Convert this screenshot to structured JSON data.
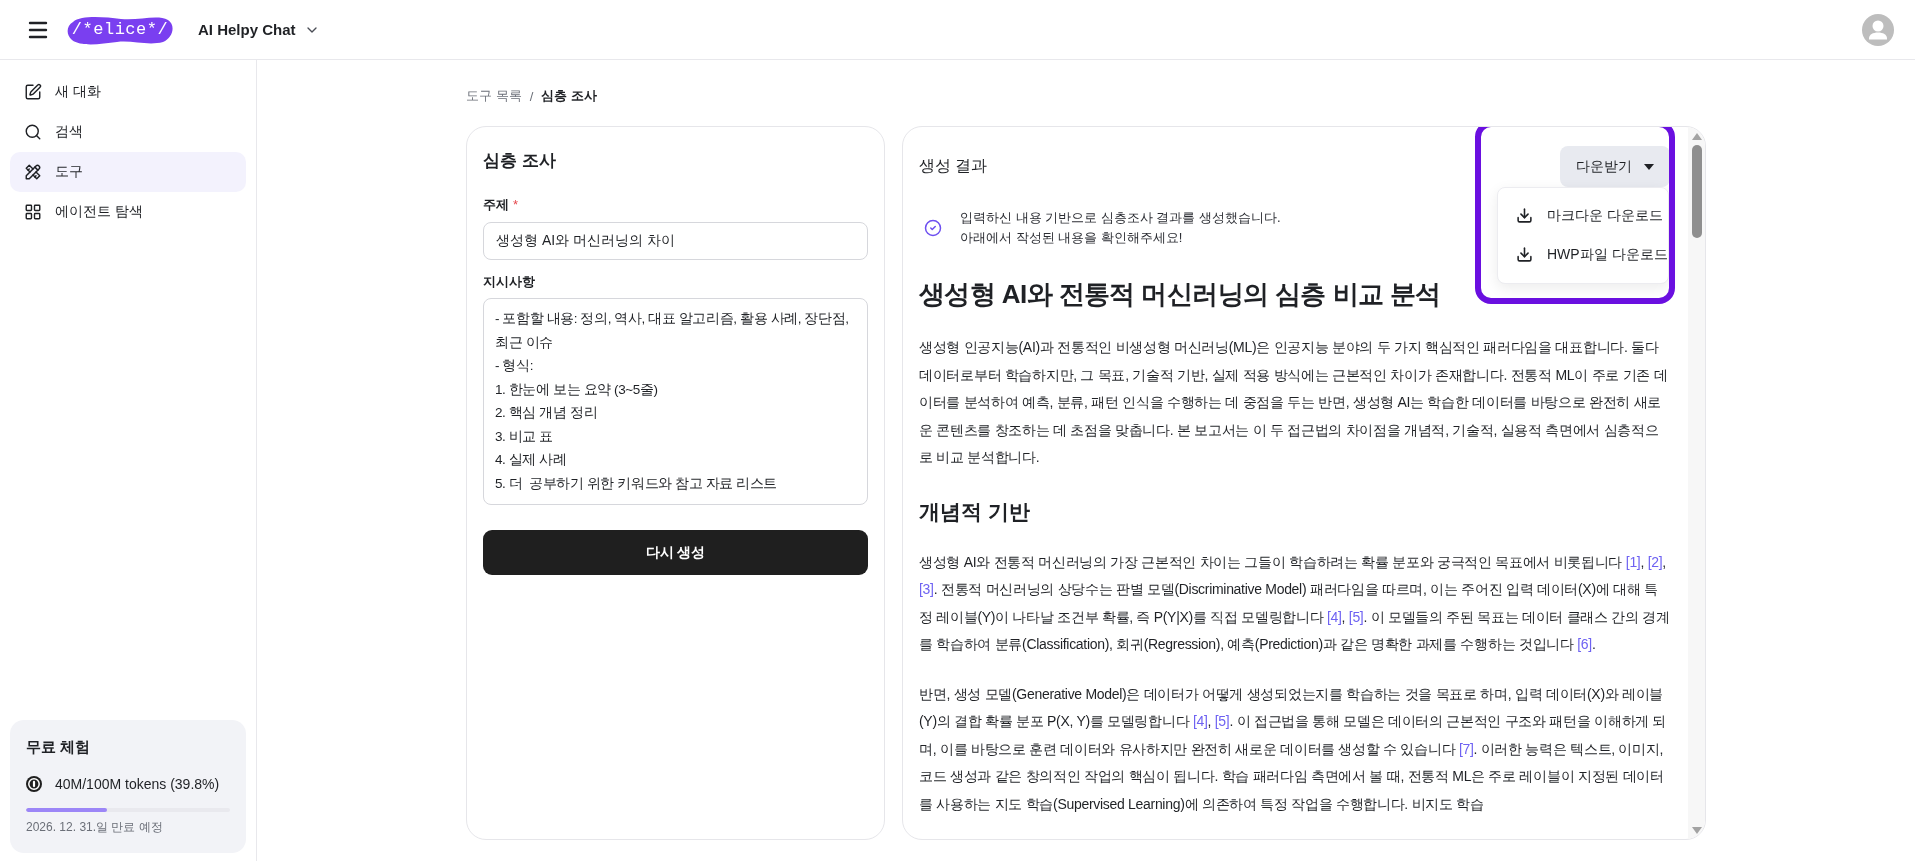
{
  "header": {
    "logo": "/*elice*/",
    "app_selector": "AI Helpy Chat"
  },
  "sidebar": {
    "items": [
      {
        "kind": "new_chat",
        "label": "새 대화",
        "selected": false
      },
      {
        "kind": "search",
        "label": "검색",
        "selected": false
      },
      {
        "kind": "tools",
        "label": "도구",
        "selected": true
      },
      {
        "kind": "explore",
        "label": "에이전트 탐색",
        "selected": false
      }
    ]
  },
  "trial": {
    "title": "무료 체험",
    "usage": "40M/100M tokens (39.8%)",
    "level": 0.398,
    "expiry": "2026. 12. 31.일 만료 예정"
  },
  "breadcrumb": {
    "separator": "/",
    "items": [
      {
        "label": "도구 목록",
        "current": false
      },
      {
        "label": "심층 조사",
        "current": true
      }
    ]
  },
  "form": {
    "title": "심층 조사",
    "fields": [
      {
        "kind": "input",
        "label": "주제",
        "required_mark": "*",
        "value": "생성형 AI와 머신러닝의 차이"
      },
      {
        "kind": "textarea",
        "label": "지시사항",
        "value": "- 포함할 내용: 정의, 역사, 대표 알고리즘, 활용 사례, 장단점, 최근 이슈\n- 형식:\n1. 한눈에 보는 요약 (3~5줄)\n2. 핵심 개념 정리\n3. 비교 표\n4. 실제 사례\n5. 더  공부하기 위한 키워드와 참고 자료 리스트"
      }
    ],
    "submit": "다시 생성"
  },
  "result": {
    "title": "생성 결과",
    "download": {
      "label": "다운받기",
      "expanded": true,
      "highlighted": true,
      "options": [
        {
          "label": "마크다운 다운로드"
        },
        {
          "label": "HWP파일 다운로드"
        }
      ]
    },
    "notice": {
      "lines": [
        "입력하신 내용 기반으로 심층조사 결과를 생성했습니다.",
        "아래에서 작성된 내용을 확인해주세요!"
      ]
    },
    "article": [
      {
        "kind": "h1",
        "text": "생성형 AI와 전통적 머신러닝의 심층 비교 분석"
      },
      {
        "kind": "p",
        "segments": [
          {
            "kind": "text",
            "text": "생성형 인공지능(AI)과 전통적인 비생성형 머신러닝(ML)은 인공지능 분야의 두 가지 핵심적인 패러다임을 대표합니다. 둘다 데이터로부터 학습하지만, 그 목표, 기술적 기반, 실제 적용 방식에는 근본적인 차이가 존재합니다. 전통적 ML이 주로 기존 데이터를 분석하여 예측, 분류, 패턴 인식을 수행하는 데 중점을 두는 반면, 생성형 AI는 학습한 데이터를 바탕으로 완전히 새로운 콘텐츠를 창조하는 데 초점을 맞춥니다. 본 보고서는 이 두 접근법의 차이점을 개념적, 기술적, 실용적 측면에서 심층적으로 비교 분석합니다."
          }
        ]
      },
      {
        "kind": "h2",
        "text": "개념적 기반"
      },
      {
        "kind": "p",
        "segments": [
          {
            "kind": "text",
            "text": "생성형 AI와 전통적 머신러닝의 가장 근본적인 차이는 그들이 학습하려는 확률 분포와 궁극적인 목표에서 비롯됩니다 "
          },
          {
            "kind": "cite",
            "text": "[1]"
          },
          {
            "kind": "text",
            "text": ", "
          },
          {
            "kind": "cite",
            "text": "[2]"
          },
          {
            "kind": "text",
            "text": ", "
          },
          {
            "kind": "cite",
            "text": "[3]"
          },
          {
            "kind": "text",
            "text": ". 전통적 머신러닝의 상당수는 판별 모델(Discriminative Model) 패러다임을 따르며, 이는 주어진 입력 데이터(X)에 대해 특정 레이블(Y)이 나타날 조건부 확률, 즉 P(Y|X)를 직접 모델링합니다 "
          },
          {
            "kind": "cite",
            "text": "[4]"
          },
          {
            "kind": "text",
            "text": ", "
          },
          {
            "kind": "cite",
            "text": "[5]"
          },
          {
            "kind": "text",
            "text": ". 이 모델들의 주된 목표는 데이터 클래스 간의 경계를 학습하여 분류(Classification), 회귀(Regression), 예측(Prediction)과 같은 명확한 과제를 수행하는 것입니다 "
          },
          {
            "kind": "cite",
            "text": "[6]"
          },
          {
            "kind": "text",
            "text": "."
          }
        ]
      },
      {
        "kind": "p",
        "segments": [
          {
            "kind": "text",
            "text": "반면, 생성 모델(Generative Model)은 데이터가 어떻게 생성되었는지를 학습하는 것을 목표로 하며, 입력 데이터(X)와 레이블(Y)의 결합 확률 분포 P(X, Y)를 모델링합니다 "
          },
          {
            "kind": "cite",
            "text": "[4]"
          },
          {
            "kind": "text",
            "text": ", "
          },
          {
            "kind": "cite",
            "text": "[5]"
          },
          {
            "kind": "text",
            "text": ". 이 접근법을 통해 모델은 데이터의 근본적인 구조와 패턴을 이해하게 되며, 이를 바탕으로 훈련 데이터와 유사하지만 완전히 새로운 데이터를 생성할 수 있습니다 "
          },
          {
            "kind": "cite",
            "text": "[7]"
          },
          {
            "kind": "text",
            "text": ". 이러한 능력은 텍스트, 이미지, 코드 생성과 같은 창의적인 작업의 핵심이 됩니다. 학습 패러다임 측면에서 볼 때, 전통적 ML은 주로 레이블이 지정된 데이터를 사용하는 지도 학습(Supervised Learning)에 의존하여 특정 작업을 수행합니다. 비지도 학습"
          }
        ]
      }
    ]
  }
}
